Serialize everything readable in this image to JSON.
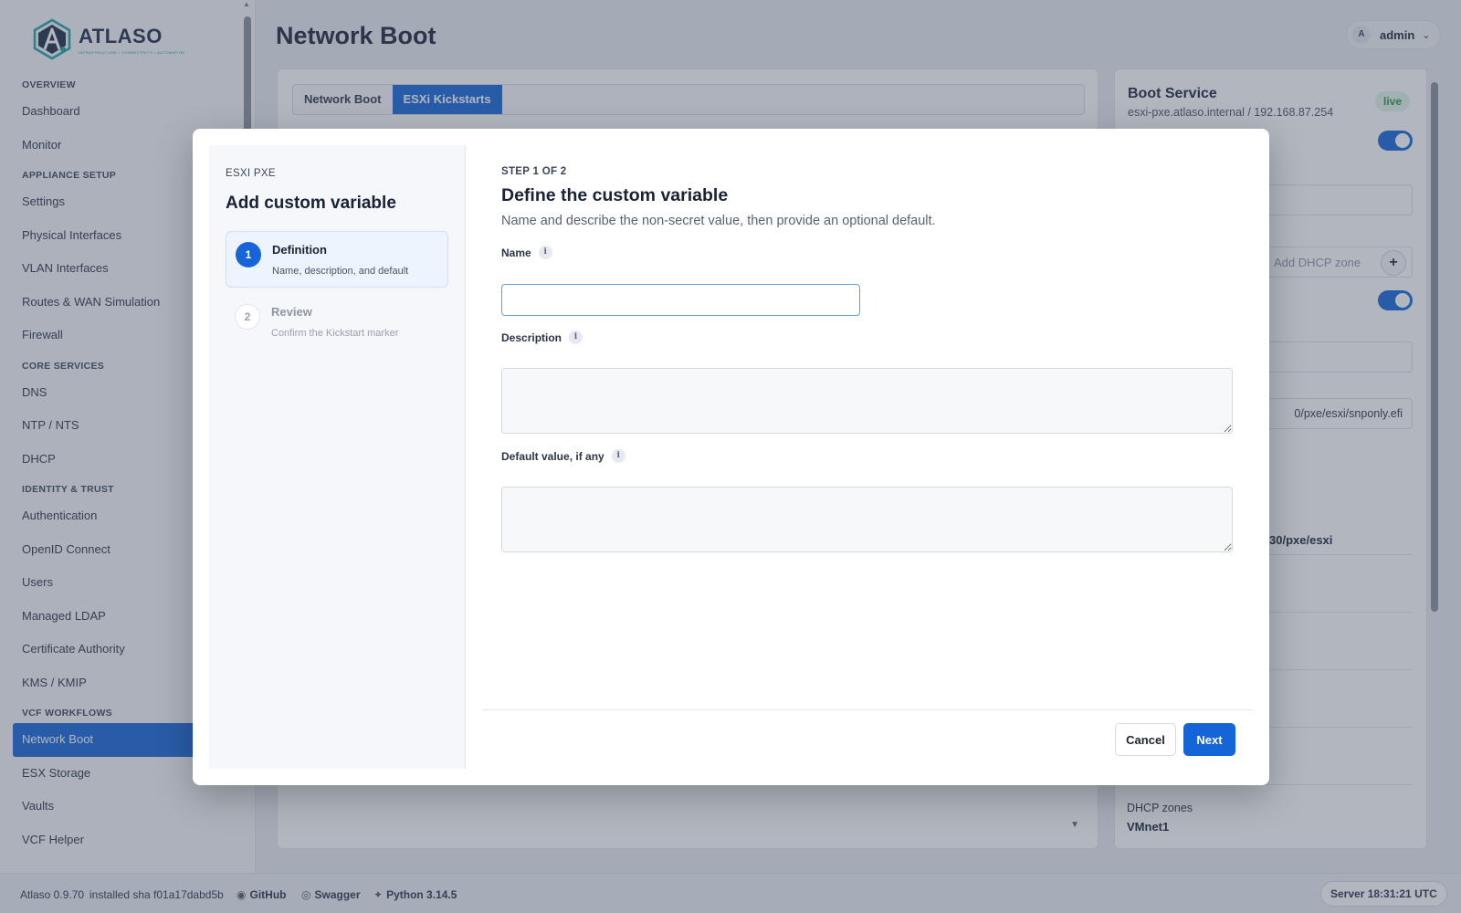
{
  "app": {
    "name": "ATLASO",
    "tagline": "INFRASTRUCTURE • CONNECTIVITY • AUTOMATION",
    "page_title": "Network Boot",
    "user": {
      "initial": "A",
      "name": "admin"
    }
  },
  "sidebar": {
    "sections": [
      {
        "label": "OVERVIEW",
        "items": [
          "Dashboard",
          "Monitor"
        ]
      },
      {
        "label": "APPLIANCE SETUP",
        "items": [
          "Settings",
          "Physical Interfaces",
          "VLAN Interfaces",
          "Routes & WAN Simulation",
          "Firewall"
        ]
      },
      {
        "label": "CORE SERVICES",
        "items": [
          "DNS",
          "NTP / NTS",
          "DHCP"
        ]
      },
      {
        "label": "IDENTITY & TRUST",
        "items": [
          "Authentication",
          "OpenID Connect",
          "Users",
          "Managed LDAP",
          "Certificate Authority",
          "KMS / KMIP"
        ]
      },
      {
        "label": "VCF WORKFLOWS",
        "items": [
          "Network Boot",
          "ESX Storage",
          "Vaults",
          "VCF Helper"
        ]
      }
    ],
    "active_item": "Network Boot"
  },
  "main": {
    "tabs": [
      {
        "label": "Network Boot",
        "active": false
      },
      {
        "label": "ESXi Kickstarts",
        "active": true
      }
    ]
  },
  "right_panel": {
    "title": "Boot Service",
    "subtitle": "esxi-pxe.atlaso.internal / 192.168.87.254",
    "status": "live",
    "dhcp_zone_placeholder": "Add DHCP zone",
    "efi_path": "0/pxe/esxi/snponly.efi",
    "http_path": "30/pxe/esxi",
    "dhcp_zones_label": "DHCP zones",
    "dhcp_zones_value": "VMnet1"
  },
  "footer": {
    "version": "Atlaso 0.9.70",
    "installed": "installed sha f01a17dabd5b",
    "github": "GitHub",
    "swagger": "Swagger",
    "python": "Python 3.14.5",
    "server_time": "Server 18:31:21 UTC"
  },
  "modal": {
    "kicker": "ESXI PXE",
    "title": "Add custom variable",
    "steps": [
      {
        "num": "1",
        "title": "Definition",
        "desc": "Name, description, and default",
        "active": true
      },
      {
        "num": "2",
        "title": "Review",
        "desc": "Confirm the Kickstart marker",
        "active": false
      }
    ],
    "step_indicator": "STEP 1 OF 2",
    "heading": "Define the custom variable",
    "subheading": "Name and describe the non-secret value, then provide an optional default.",
    "fields": {
      "name_label": "Name",
      "name_value": "",
      "description_label": "Description",
      "description_value": "",
      "default_label": "Default value, if any",
      "default_value": ""
    },
    "buttons": {
      "cancel": "Cancel",
      "next": "Next"
    }
  }
}
